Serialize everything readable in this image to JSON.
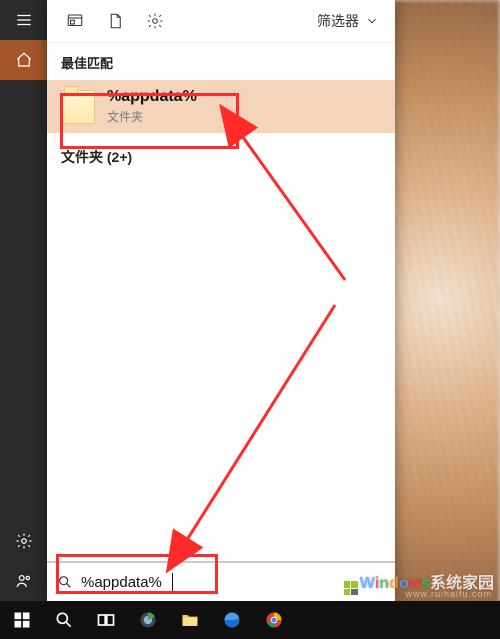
{
  "panel": {
    "filter_label": "筛选器",
    "best_match_header": "最佳匹配",
    "best_match": {
      "title": "%appdata%",
      "subtitle": "文件夹"
    },
    "folders_label": "文件夹",
    "folders_count": "(2+)"
  },
  "search": {
    "query": "%appdata%"
  },
  "rail": {
    "items": [
      "menu",
      "home",
      "settings",
      "contact"
    ]
  },
  "taskbar": {
    "items": [
      "start",
      "search",
      "task-view",
      "browser-360",
      "file-explorer",
      "edge",
      "chrome"
    ]
  },
  "watermark": {
    "brand_letters": [
      "W",
      "i",
      "n",
      "d",
      "o",
      "w",
      "s"
    ],
    "brand_tail": "系统家园",
    "url": "www.ruihaifu.com"
  },
  "annotations": {
    "boxes": [
      "best-match-box",
      "search-box-box"
    ],
    "arrows": 2
  }
}
